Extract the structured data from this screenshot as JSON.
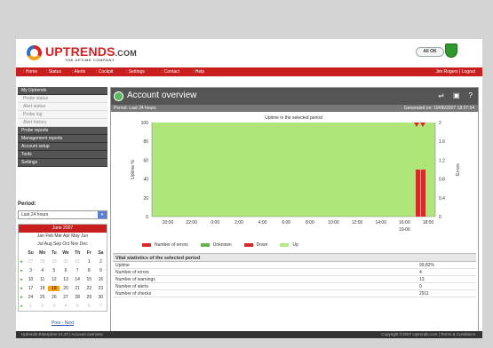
{
  "brand": {
    "name": "UPTRENDS",
    "domain": ".COM",
    "tagline": "THE UPTIME COMPANY",
    "status_button": "All OK"
  },
  "nav": {
    "items": [
      ": Home",
      ": Status",
      ": Alerts",
      ": Cockpit",
      ": Settings",
      ": Contact",
      ": Help"
    ],
    "user": "Jim Rogers | Logout"
  },
  "sidebar": {
    "sections": [
      {
        "label": "My Uptrends",
        "subs": [
          "Probe status",
          "Alert status",
          "Probe log",
          "Alert history"
        ]
      },
      {
        "label": "Probe reports",
        "subs": []
      },
      {
        "label": "Management reports",
        "subs": []
      },
      {
        "label": "Account setup",
        "subs": []
      },
      {
        "label": "Tools",
        "subs": []
      },
      {
        "label": "Settings",
        "subs": []
      }
    ]
  },
  "period": {
    "label": "Period:",
    "selected": "Last 24 hours"
  },
  "calendar": {
    "month": "June 2007",
    "months_row1": "Jan Feb Mar Apr May Jun",
    "months_row2": "Jul Aug Sep Oct Nov Dec",
    "days": [
      "Su",
      "Mo",
      "Tu",
      "We",
      "Th",
      "Fr",
      "Sa"
    ],
    "weeks": [
      [
        "27",
        "28",
        "29",
        "30",
        "31",
        "1",
        "2"
      ],
      [
        "3",
        "4",
        "5",
        "6",
        "7",
        "8",
        "9"
      ],
      [
        "10",
        "11",
        "12",
        "13",
        "14",
        "15",
        "16"
      ],
      [
        "17",
        "18",
        "19",
        "20",
        "21",
        "22",
        "23"
      ],
      [
        "24",
        "25",
        "26",
        "27",
        "28",
        "29",
        "30"
      ],
      [
        "1",
        "2",
        "3",
        "4",
        "5",
        "6",
        "7"
      ]
    ],
    "prev": "Prev",
    "next": "Next"
  },
  "main": {
    "title": "Account overview",
    "period_text": "Period: Last 24 hours",
    "generated_text": "Generated on: 19/06/2007 18:37:54"
  },
  "chart_data": {
    "type": "bar",
    "title": "Uptime in the selected period",
    "ylabel": "Uptime %",
    "y2label": "Errors",
    "x_ticks": [
      "20:00",
      "22:00",
      "0:00",
      "2:00",
      "4:00",
      "6:00",
      "8:00",
      "10:00",
      "12:00",
      "14:00",
      "16:00",
      "18:00"
    ],
    "x_sublabel": "19-06",
    "y_ticks": [
      0,
      20,
      40,
      60,
      80,
      100
    ],
    "y2_ticks": [
      0,
      0.4,
      0.8,
      1.2,
      1.6,
      2
    ],
    "ylim": [
      0,
      100
    ],
    "y2lim": [
      0,
      2
    ],
    "series": [
      {
        "name": "Up",
        "color": "#aee67a",
        "values": [
          100
        ]
      },
      {
        "name": "Number of errors",
        "color": "#d82828",
        "values": [
          1,
          1
        ]
      }
    ]
  },
  "legend": [
    {
      "name": "Number of errors",
      "color": "#d82828"
    },
    {
      "name": "Unknown",
      "color": "#6ab04c"
    },
    {
      "name": "Down",
      "color": "#d82828"
    },
    {
      "name": "Up",
      "color": "#b6e88a"
    }
  ],
  "vital": {
    "title": "Vital statistics of the selected period",
    "rows": [
      {
        "label": "Uptime",
        "value": "99.82%"
      },
      {
        "label": "Number of errors",
        "value": "4"
      },
      {
        "label": "Number of warnings",
        "value": "13"
      },
      {
        "label": "Number of alerts",
        "value": "0"
      },
      {
        "label": "Number of checks",
        "value": "2911"
      }
    ]
  },
  "footer": {
    "left": "Uptrends Enterprise V1.37 | Account overview",
    "right": "Copyright ©2007 Uptrends.com | Terms & Conditions"
  }
}
